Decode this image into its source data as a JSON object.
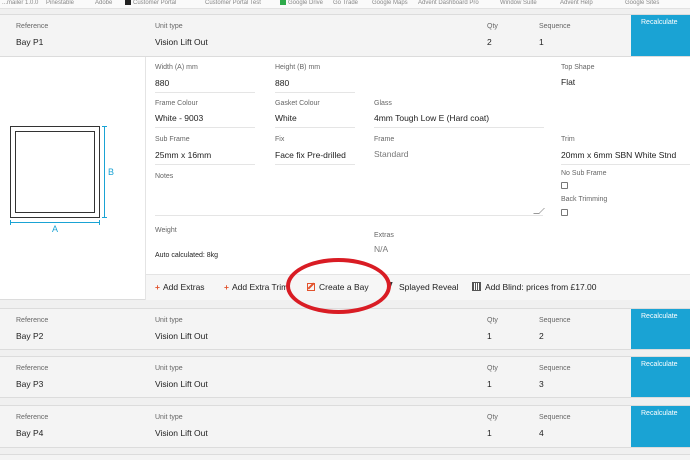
{
  "bookmarks": [
    "...mailer 1.0.0",
    "Pinestable",
    "Adobe",
    "Customer Portal",
    "Customer Portal Test",
    "Google Drive",
    "Go Trade",
    "Google Maps",
    "Advent Dashboard Pro",
    "Window Suite",
    "Advent Help",
    "Google Sites"
  ],
  "labels": {
    "reference": "Reference",
    "unit_type": "Unit type",
    "qty": "Qty",
    "sequence": "Sequence",
    "recalculate": "Recalculate"
  },
  "bays": [
    {
      "reference": "Bay P1",
      "unit_type": "Vision Lift Out",
      "qty": "2",
      "sequence": "1"
    },
    {
      "reference": "Bay P2",
      "unit_type": "Vision Lift Out",
      "qty": "1",
      "sequence": "2"
    },
    {
      "reference": "Bay P3",
      "unit_type": "Vision Lift Out",
      "qty": "1",
      "sequence": "3"
    },
    {
      "reference": "Bay P4",
      "unit_type": "Vision Lift Out",
      "qty": "1",
      "sequence": "4"
    }
  ],
  "diagram": {
    "dim_a": "A",
    "dim_b": "B"
  },
  "details": {
    "width_label": "Width (A) mm",
    "width_value": "880",
    "height_label": "Height (B) mm",
    "height_value": "880",
    "top_shape_label": "Top Shape",
    "top_shape_value": "Flat",
    "frame_colour_label": "Frame Colour",
    "frame_colour_value": "White - 9003",
    "gasket_colour_label": "Gasket Colour",
    "gasket_colour_value": "White",
    "glass_label": "Glass",
    "glass_value": "4mm Tough Low E (Hard coat)",
    "sub_frame_label": "Sub Frame",
    "sub_frame_value": "25mm x 16mm",
    "fix_label": "Fix",
    "fix_value": "Face fix Pre-drilled",
    "frame_label": "Frame",
    "frame_value": "Standard",
    "trim_label": "Trim",
    "trim_value": "20mm x 6mm SBN White Stnd",
    "notes_label": "Notes",
    "no_sub_frame_label": "No Sub Frame",
    "back_trimming_label": "Back Trimming",
    "weight_label": "Weight",
    "weight_value": "Auto calculated: 8kg",
    "extras_label": "Extras",
    "extras_value": "N/A"
  },
  "actions": {
    "add_extras": "Add Extras",
    "add_extra_trim": "Add Extra Trim",
    "create_bay": "Create a Bay",
    "splayed_reveal": "Splayed Reveal",
    "add_blind": "Add Blind: prices from £17.00"
  },
  "colors": {
    "accent": "#1aa3d4",
    "action_icon": "#e2532d",
    "highlight": "#d91c24"
  }
}
